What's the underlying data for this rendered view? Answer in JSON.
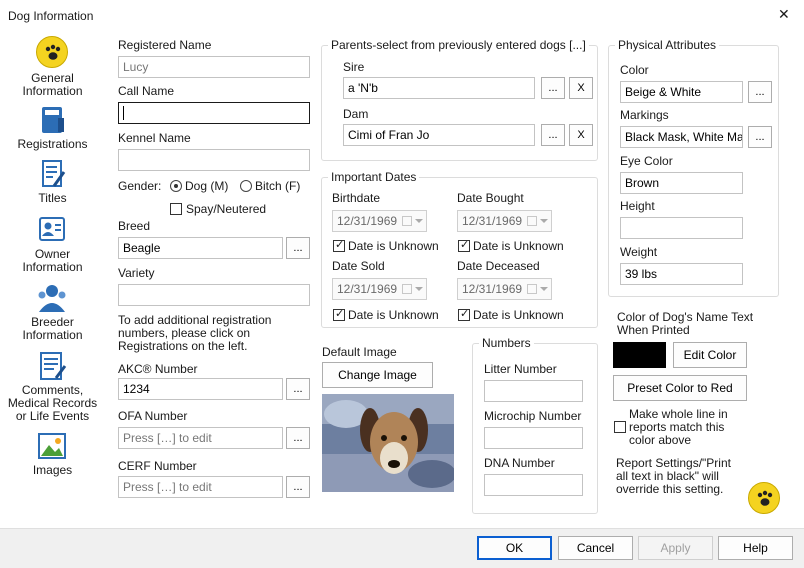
{
  "window": {
    "title": "Dog Information",
    "close_glyph": "✕"
  },
  "sidebar": {
    "items": [
      {
        "label": "General\nInformation",
        "icon": "paw-icon"
      },
      {
        "label": "Registrations",
        "icon": "book-icon"
      },
      {
        "label": "Titles",
        "icon": "document-pencil-icon"
      },
      {
        "label": "Owner\nInformation",
        "icon": "owner-card-icon"
      },
      {
        "label": "Breeder\nInformation",
        "icon": "people-icon"
      },
      {
        "label": "Comments,\nMedical Records\nor Life Events",
        "icon": "notes-icon"
      },
      {
        "label": "Images",
        "icon": "picture-icon"
      }
    ]
  },
  "left": {
    "registered_name_label": "Registered Name",
    "registered_name_value": "Lucy",
    "call_name_label": "Call Name",
    "call_name_value": "",
    "kennel_name_label": "Kennel Name",
    "kennel_name_value": "",
    "gender_label": "Gender:",
    "gender_dog": "Dog (M)",
    "gender_bitch": "Bitch (F)",
    "spay_label": "Spay/Neutered",
    "breed_label": "Breed",
    "breed_value": "Beagle",
    "variety_label": "Variety",
    "variety_value": "",
    "reg_note": "To add additional registration numbers, please click on Registrations on the left.",
    "akc_label": "AKC® Number",
    "akc_value": "1234",
    "ofa_label": "OFA Number",
    "ofa_value": "Press […] to edit",
    "cerf_label": "CERF Number",
    "cerf_value": "Press […] to edit",
    "ellipsis": "..."
  },
  "parents": {
    "title": "Parents-select from previously entered dogs [...]",
    "sire_label": "Sire",
    "sire_value": "a 'N'b",
    "dam_label": "Dam",
    "dam_value": "Cimi of Fran Jo",
    "ellipsis": "...",
    "clear": "X"
  },
  "dates": {
    "title": "Important Dates",
    "birthdate_label": "Birthdate",
    "birthdate_value": "12/31/1969",
    "bought_label": "Date Bought",
    "bought_value": "12/31/1969",
    "sold_label": "Date Sold",
    "sold_value": "12/31/1969",
    "deceased_label": "Date Deceased",
    "deceased_value": "12/31/1969",
    "unknown_label": "Date is Unknown"
  },
  "image": {
    "label": "Default Image",
    "change_button": "Change Image"
  },
  "numbers": {
    "title": "Numbers",
    "litter_label": "Litter Number",
    "microchip_label": "Microchip Number",
    "dna_label": "DNA Number"
  },
  "physical": {
    "title": "Physical Attributes",
    "color_label": "Color",
    "color_value": "Beige & White",
    "markings_label": "Markings",
    "markings_value": "Black Mask, White Marki",
    "eye_label": "Eye Color",
    "eye_value": "Brown",
    "height_label": "Height",
    "height_value": "",
    "weight_label": "Weight",
    "weight_value": "39 lbs",
    "ellipsis": "..."
  },
  "name_color": {
    "label": "Color of Dog's Name Text When Printed",
    "swatch_color": "#000000",
    "edit_button": "Edit Color",
    "preset_button": "Preset Color to Red",
    "whole_line_label": "Make whole line in reports match this color above",
    "note": "Report Settings/\"Print all text in black\" will override this setting."
  },
  "footer": {
    "ok": "OK",
    "cancel": "Cancel",
    "apply": "Apply",
    "help": "Help"
  },
  "colors": {
    "accent": "#0b5fd1",
    "paw": "#f4d320",
    "nav_blue": "#2c6db5"
  }
}
